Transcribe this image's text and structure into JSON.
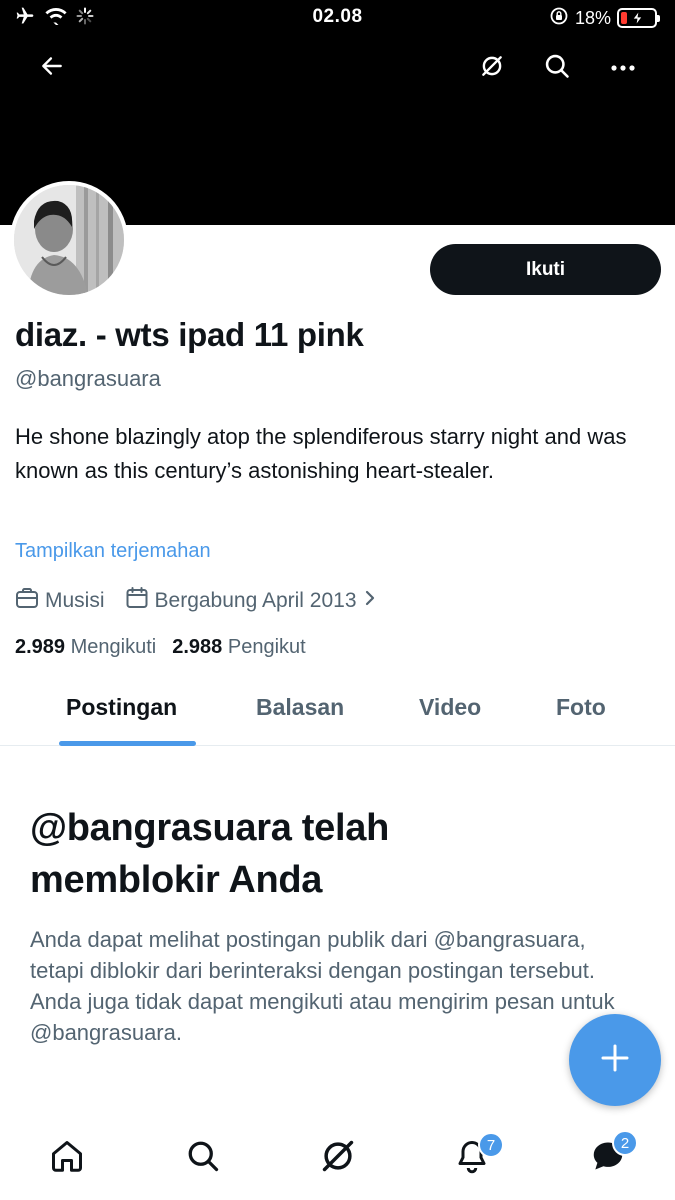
{
  "status_bar": {
    "time": "02.08",
    "battery_percent": "18%",
    "battery_level": 0.18
  },
  "header": {
    "icons": [
      "back-arrow-icon",
      "grok-icon",
      "search-icon",
      "more-icon"
    ]
  },
  "profile": {
    "follow_label": "Ikuti",
    "display_name": "diaz. - wts ipad 11 pink",
    "handle": "@bangrasuara",
    "bio": "He shone blazingly atop the splendiferous starry night and was known as this century’s astonishing heart-stealer.",
    "translate_link": "Tampilkan terjemahan",
    "category": "Musisi",
    "joined": "Bergabung April 2013",
    "following_count": "2.989",
    "following_label": "Mengikuti",
    "followers_count": "2.988",
    "followers_label": "Pengikut"
  },
  "tabs": [
    {
      "label": "Postingan",
      "active": true
    },
    {
      "label": "Balasan",
      "active": false
    },
    {
      "label": "Video",
      "active": false
    },
    {
      "label": "Foto",
      "active": false
    }
  ],
  "blocked": {
    "title": "@bangrasuara telah memblokir Anda",
    "message": "Anda dapat melihat postingan publik dari @bangrasuara, tetapi diblokir dari berinteraksi dengan postingan tersebut. Anda juga tidak dapat mengikuti atau mengirim pesan untuk @bangrasuara."
  },
  "bottom_nav": {
    "items": [
      "home-icon",
      "search-icon",
      "grok-icon",
      "notifications-icon",
      "messages-icon"
    ],
    "notifications_badge": "7",
    "messages_badge": "2"
  },
  "colors": {
    "accent": "#4a99e9",
    "text_primary": "#0f1419",
    "text_secondary": "#536471",
    "battery_low": "#ff3b30"
  }
}
